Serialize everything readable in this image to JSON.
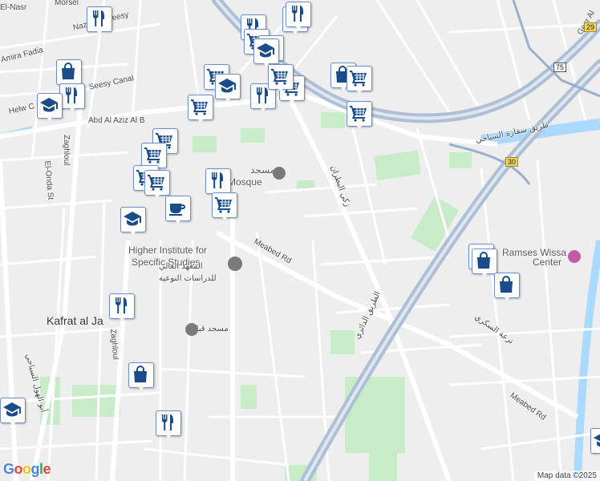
{
  "map": {
    "colors": {
      "background": "#eeeeee",
      "road": "#ffffff",
      "highway": "#aebfd6",
      "water": "#aadaff",
      "park": "#c8ecc8",
      "marker_icon": "#1a4c8b"
    },
    "labels": [
      {
        "text": "El-Nasr",
        "cls": "lbl"
      },
      {
        "text": "Morsel",
        "cls": "lbl"
      },
      {
        "text": "Nazlet El-Seesy",
        "cls": "lbl"
      },
      {
        "text": "Amira Fadia",
        "cls": "lbl"
      },
      {
        "text": "Seesy Canal",
        "cls": "lbl"
      },
      {
        "text": "Helw C",
        "cls": "lbl"
      },
      {
        "text": "Abd Al Aziz Al B",
        "cls": "lbl"
      },
      {
        "text": "Zaghloul",
        "cls": "lbl"
      },
      {
        "text": "El-Onda St",
        "cls": "lbl"
      },
      {
        "text": "مسجد",
        "cls": "lbl poi ar"
      },
      {
        "text": "Mosque",
        "cls": "lbl poi"
      },
      {
        "text": "Meabed Rd",
        "cls": "lbl"
      },
      {
        "text": "Higher Institute for",
        "cls": "lbl poi"
      },
      {
        "text": "Specific Studies",
        "cls": "lbl poi"
      },
      {
        "text": "المعهد العالي",
        "cls": "lbl ar"
      },
      {
        "text": "للدراسات النوعية",
        "cls": "lbl ar"
      },
      {
        "text": "Kafrat al Ja",
        "cls": "lbl big"
      },
      {
        "text": "مسجد قباء",
        "cls": "lbl ar"
      },
      {
        "text": "Zaghloul",
        "cls": "lbl"
      },
      {
        "text": "أبو الهول السياحي",
        "cls": "lbl ar"
      },
      {
        "text": "الطريق الدائري",
        "cls": "lbl ar"
      },
      {
        "text": "زكي البطران",
        "cls": "lbl ar"
      },
      {
        "text": "طريق سقارة السياحي",
        "cls": "lbl ar"
      },
      {
        "text": "Ramses Wissa",
        "cls": "lbl poi"
      },
      {
        "text": "Center",
        "cls": "lbl poi"
      },
      {
        "text": "ترعة السكري",
        "cls": "lbl ar"
      },
      {
        "text": "Meabed Rd",
        "cls": "lbl"
      },
      {
        "text": "Gesr Al",
        "cls": "lbl"
      }
    ],
    "shields": [
      "29",
      "75",
      "30"
    ],
    "markers": [
      "restaurant",
      "restaurant",
      "restaurant",
      "restaurant",
      "shopping-cart",
      "shopping-cart",
      "school",
      "shopping-bag",
      "restaurant",
      "school",
      "shopping-cart",
      "school",
      "shopping-cart",
      "restaurant",
      "shopping-cart",
      "shopping-cart",
      "shopping-bag",
      "shopping-cart",
      "shopping-cart",
      "shopping-cart",
      "shopping-cart",
      "shopping-cart",
      "restaurant",
      "shopping-cart",
      "shopping-cart",
      "coffee",
      "school",
      "restaurant",
      "shopping-bag",
      "restaurant",
      "school",
      "shopping-bag",
      "school",
      "shopping-bag",
      "school"
    ],
    "logo": "Google",
    "attribution": "Map data ©2025"
  }
}
